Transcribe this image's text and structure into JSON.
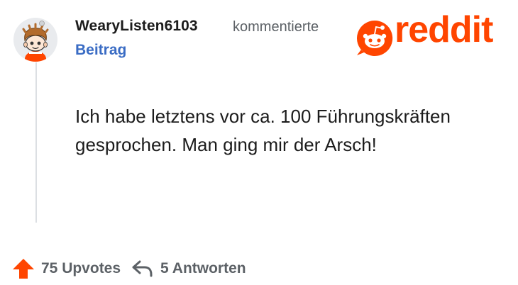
{
  "comment": {
    "username": "WearyListen6103",
    "action": "kommentierte",
    "post_link": "Beitrag",
    "text": "Ich habe letztens vor ca. 100 Führungskräften gesprochen. Man ging mir der Arsch!"
  },
  "brand": {
    "logo_text": "reddit",
    "accent_color": "#ff4500"
  },
  "footer": {
    "upvotes_label": "75 Upvotes",
    "replies_label": "5 Antworten"
  },
  "icons": {
    "avatar": "snoo-avatar-icon",
    "logo": "reddit-snoo-icon",
    "upvote": "upvote-arrow-icon",
    "reply": "reply-arrow-icon"
  }
}
